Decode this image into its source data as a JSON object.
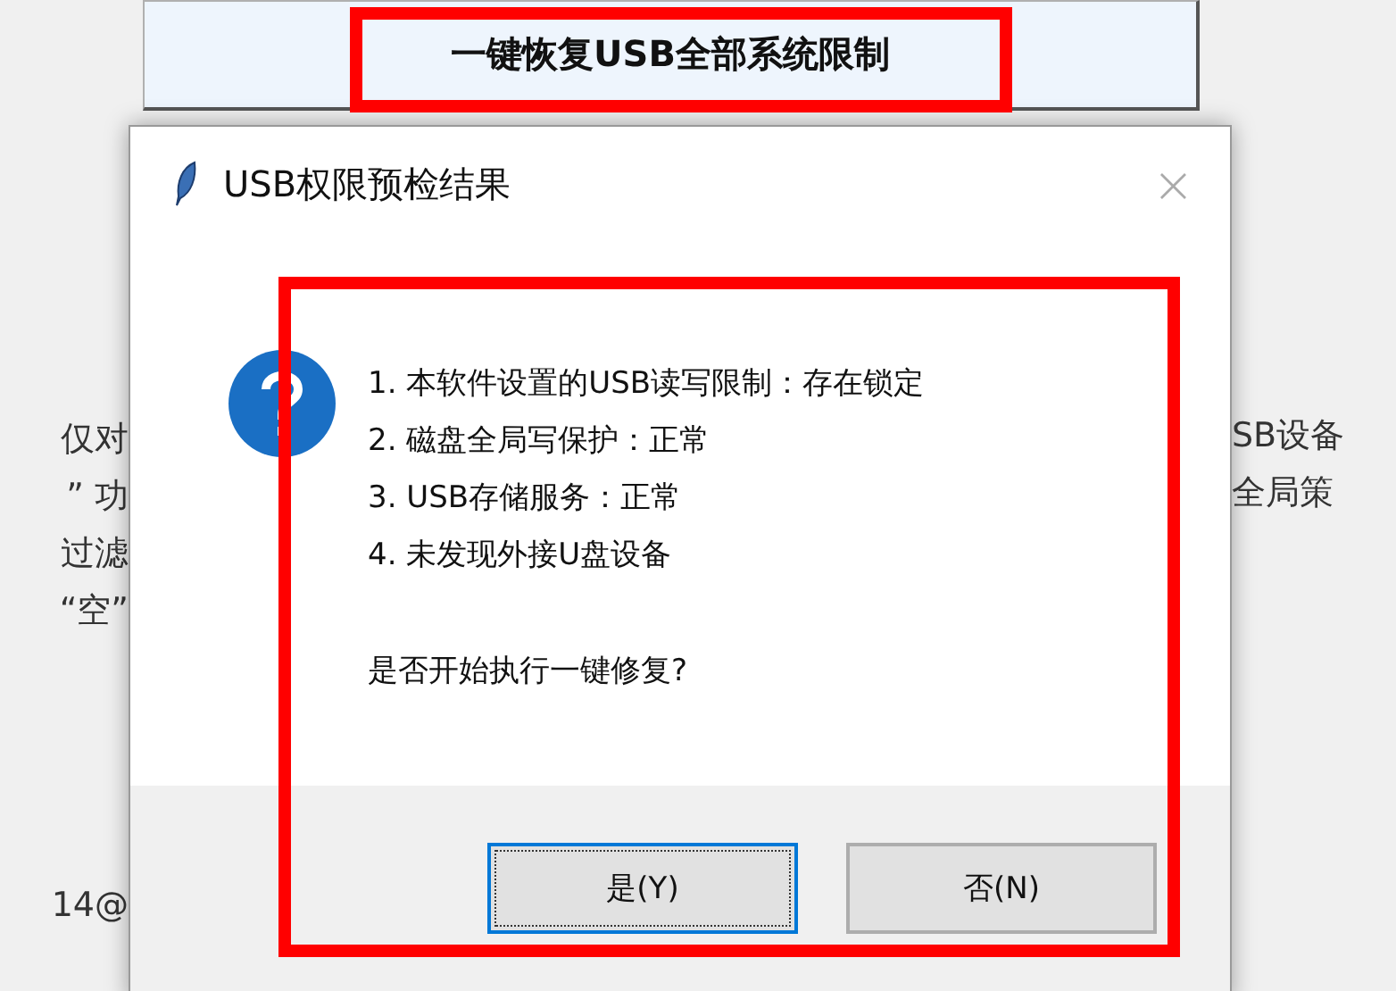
{
  "main_button": {
    "label": "一键恢复USB全部系统限制",
    "highlighted": true
  },
  "background_left": [
    "仅对",
    "” 功",
    "过滤",
    "“空”",
    "14@"
  ],
  "background_right": [
    "SB设备",
    "全局策"
  ],
  "dialog": {
    "title": "USB权限预检结果",
    "highlighted": true,
    "close": "×",
    "lines": [
      "1. 本软件设置的USB读写限制：存在锁定",
      "2. 磁盘全局写保护：正常",
      "3. USB存储服务：正常",
      "4. 未发现外接U盘设备"
    ],
    "question": "是否开始执行一键修复?",
    "buttons": [
      {
        "label": "是(Y)",
        "focused": true
      },
      {
        "label": "否(N)",
        "focused": false
      }
    ]
  }
}
